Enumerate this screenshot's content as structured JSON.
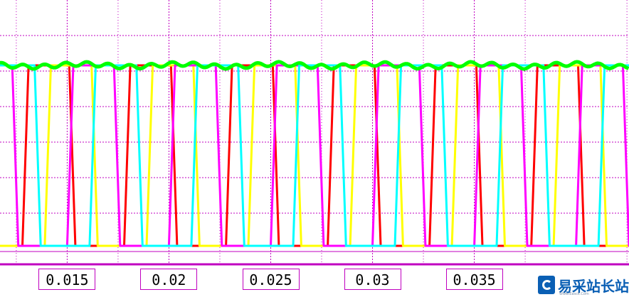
{
  "chart_data": {
    "type": "line",
    "title": "",
    "xlabel": "",
    "ylabel": "",
    "x_ticks": [
      {
        "value": 0.015,
        "label": "0.015"
      },
      {
        "value": 0.02,
        "label": "0.02"
      },
      {
        "value": 0.025,
        "label": "0.025"
      },
      {
        "value": 0.03,
        "label": "0.03"
      },
      {
        "value": 0.035,
        "label": "0.035"
      }
    ],
    "xlim": [
      0.0117,
      0.0426
    ],
    "ylim": [
      0,
      1.2
    ],
    "grid": true,
    "grid_color": "#c000c0",
    "pulse_period": 0.005,
    "high_level": 1.0,
    "low_level": 0.0,
    "series": [
      {
        "color": "#ff0000",
        "phase": 0.0011,
        "duty": 0.46
      },
      {
        "color": "#ffff00",
        "phase": 0.0022,
        "duty": 0.46
      },
      {
        "color": "#ff00ff",
        "phase": 0.0033,
        "duty": 0.46
      },
      {
        "color": "#00ffff",
        "phase": 0.0044,
        "duty": 0.46
      },
      {
        "color": "#00ff00",
        "phase": 0.0,
        "duty": 1.0
      }
    ]
  },
  "logo": {
    "text": "易采站长站",
    "sub": "Www.Easck.Com"
  }
}
